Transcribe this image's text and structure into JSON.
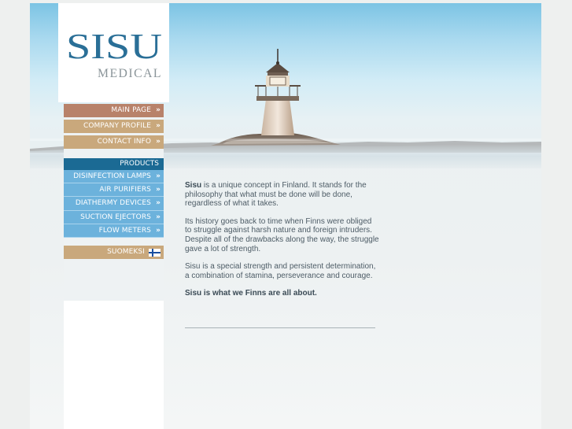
{
  "logo": {
    "wordmark": "SISU",
    "subtitle": "MEDICAL"
  },
  "nav": {
    "main": [
      {
        "label": "MAIN PAGE",
        "arrow": "»"
      },
      {
        "label": "COMPANY PROFILE",
        "arrow": "»"
      },
      {
        "label": "CONTACT INFO",
        "arrow": "»"
      }
    ],
    "products_heading": "PRODUCTS",
    "products": [
      {
        "label": "DISINFECTION LAMPS",
        "arrow": "»"
      },
      {
        "label": "AIR PURIFIERS",
        "arrow": "»"
      },
      {
        "label": "DIATHERMY DEVICES",
        "arrow": "»"
      },
      {
        "label": "SUCTION EJECTORS",
        "arrow": "»"
      },
      {
        "label": "FLOW METERS",
        "arrow": "»"
      }
    ],
    "language": {
      "label": "SUOMEKSI",
      "flag_icon": "finland-flag-icon"
    }
  },
  "content": {
    "p1_bold": "Sisu",
    "p1_rest": " is a unique concept in Finland. It stands for the philosophy that what must be done will be done, regardless of what it takes.",
    "p2": "Its history goes back to time when Finns were obliged to struggle against harsh nature and foreign intruders. Despite all of the drawbacks along the way, the struggle gave a lot of strength.",
    "p3": "Sisu is a special strength and persistent determination, a combination of stamina, perseverance and courage.",
    "p4": "Sisu is what we Finns are all about."
  },
  "colors": {
    "nav_main_active": "#b8826a",
    "nav_main": "#c9a87c",
    "products_heading": "#1b6a94",
    "products_item": "#6cb2dc",
    "logo_blue": "#2a6f97",
    "logo_grey": "#8a9499"
  }
}
